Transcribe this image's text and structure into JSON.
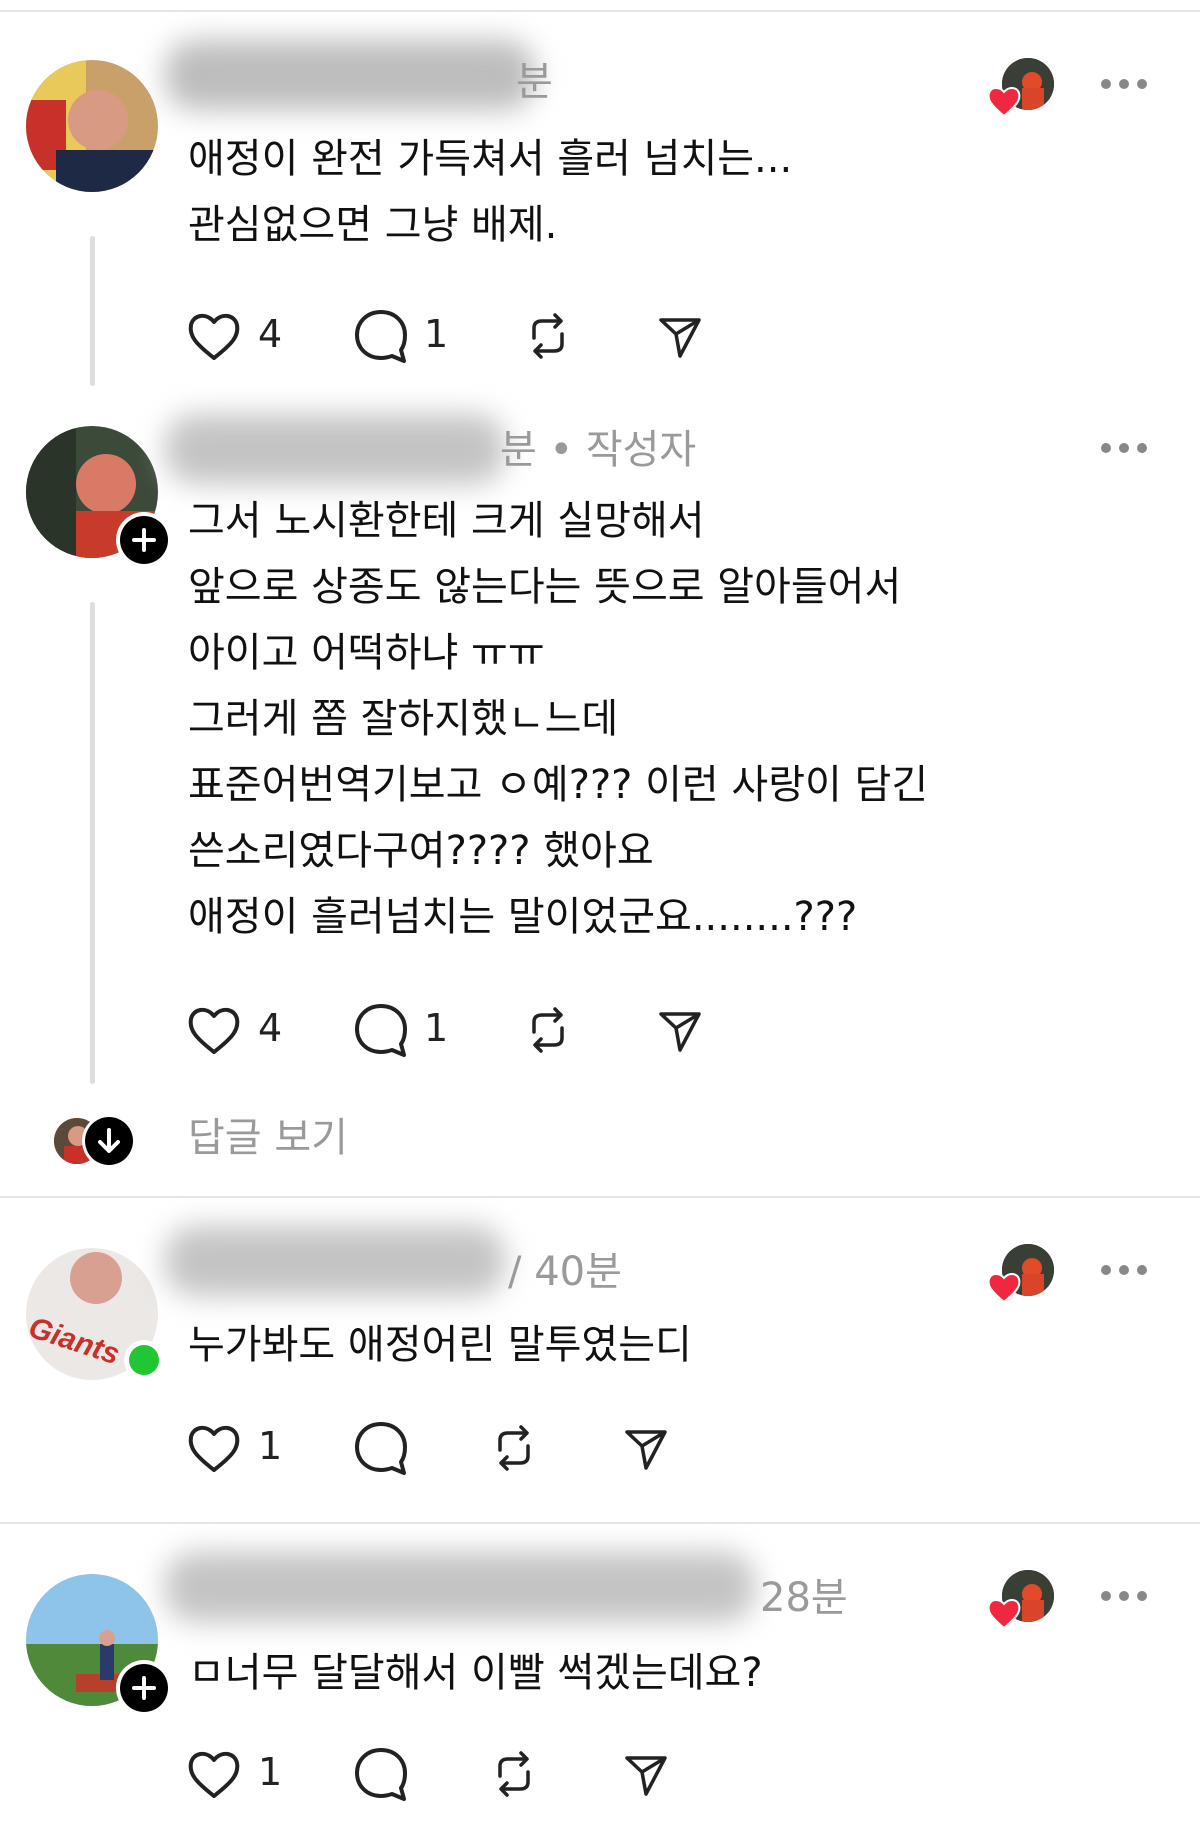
{
  "posts": [
    {
      "time_fragment": "분",
      "author_tag": "",
      "lines": [
        "애정이 완전 가득쳐서 흘러 넘치는...",
        "관심없으면 그냥 배제."
      ],
      "likes": "4",
      "replies": "1"
    },
    {
      "time_fragment": "분 • 작성자",
      "lines": [
        "그서 노시환한테 크게 실망해서",
        "앞으로 상종도 않는다는 뜻으로 알아들어서",
        "아이고 어떡하냐 ㅠㅠ",
        "그러게 쫌 잘하지했ㄴ느데",
        "표준어번역기보고 ㅇ예??? 이런 사랑이 담긴",
        "쓴소리였다구여???? 했아요",
        "애정이 흘러넘치는 말이었군요........???"
      ],
      "likes": "4",
      "replies": "1",
      "view_replies_label": "답글 보기"
    },
    {
      "time_fragment": "/ 40분",
      "lines": [
        "누가봐도 애정어린 말투였는디"
      ],
      "likes": "1",
      "replies": ""
    },
    {
      "time_fragment": "28분",
      "lines": [
        "ㅁ너무 달달해서 이빨 썩겠는데요?"
      ],
      "likes": "1",
      "replies": ""
    }
  ],
  "colors": {
    "heart_red": "#f0283f",
    "online_green": "#22c532",
    "meta_gray": "#9a9a9a"
  },
  "icons": [
    "heart-icon",
    "comment-icon",
    "repost-icon",
    "share-icon",
    "more-icon",
    "plus-icon",
    "arrow-down-icon"
  ]
}
